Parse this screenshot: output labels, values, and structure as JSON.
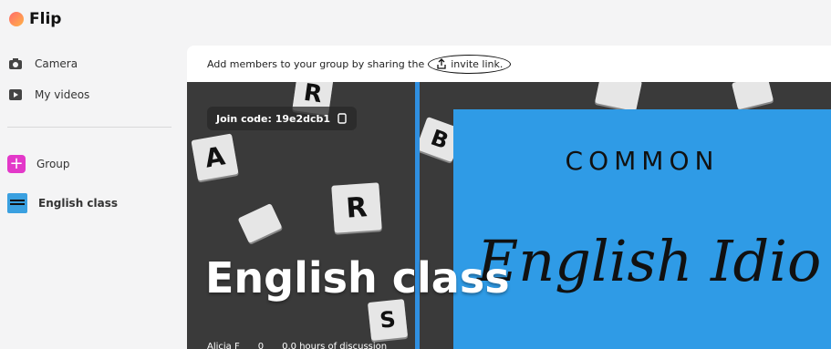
{
  "app": {
    "name": "Flip"
  },
  "sidebar": {
    "items": [
      {
        "label": "Camera",
        "icon": "camera-icon"
      },
      {
        "label": "My videos",
        "icon": "video-icon"
      }
    ],
    "groups": [
      {
        "label": "Group",
        "icon": "plus-icon"
      },
      {
        "label": "English class",
        "icon": "group-thumbnail"
      }
    ]
  },
  "main": {
    "share_text": "Add members to your group by sharing the",
    "invite_link": "invite link."
  },
  "banner": {
    "join_code": "Join code: 19e2dcb1",
    "title": "English class",
    "poster_top": "COMMON",
    "poster_script": "English Idio",
    "meta_user": "Alicia F",
    "meta_count": "0",
    "meta_hours": "0.0 hours of discussion"
  }
}
